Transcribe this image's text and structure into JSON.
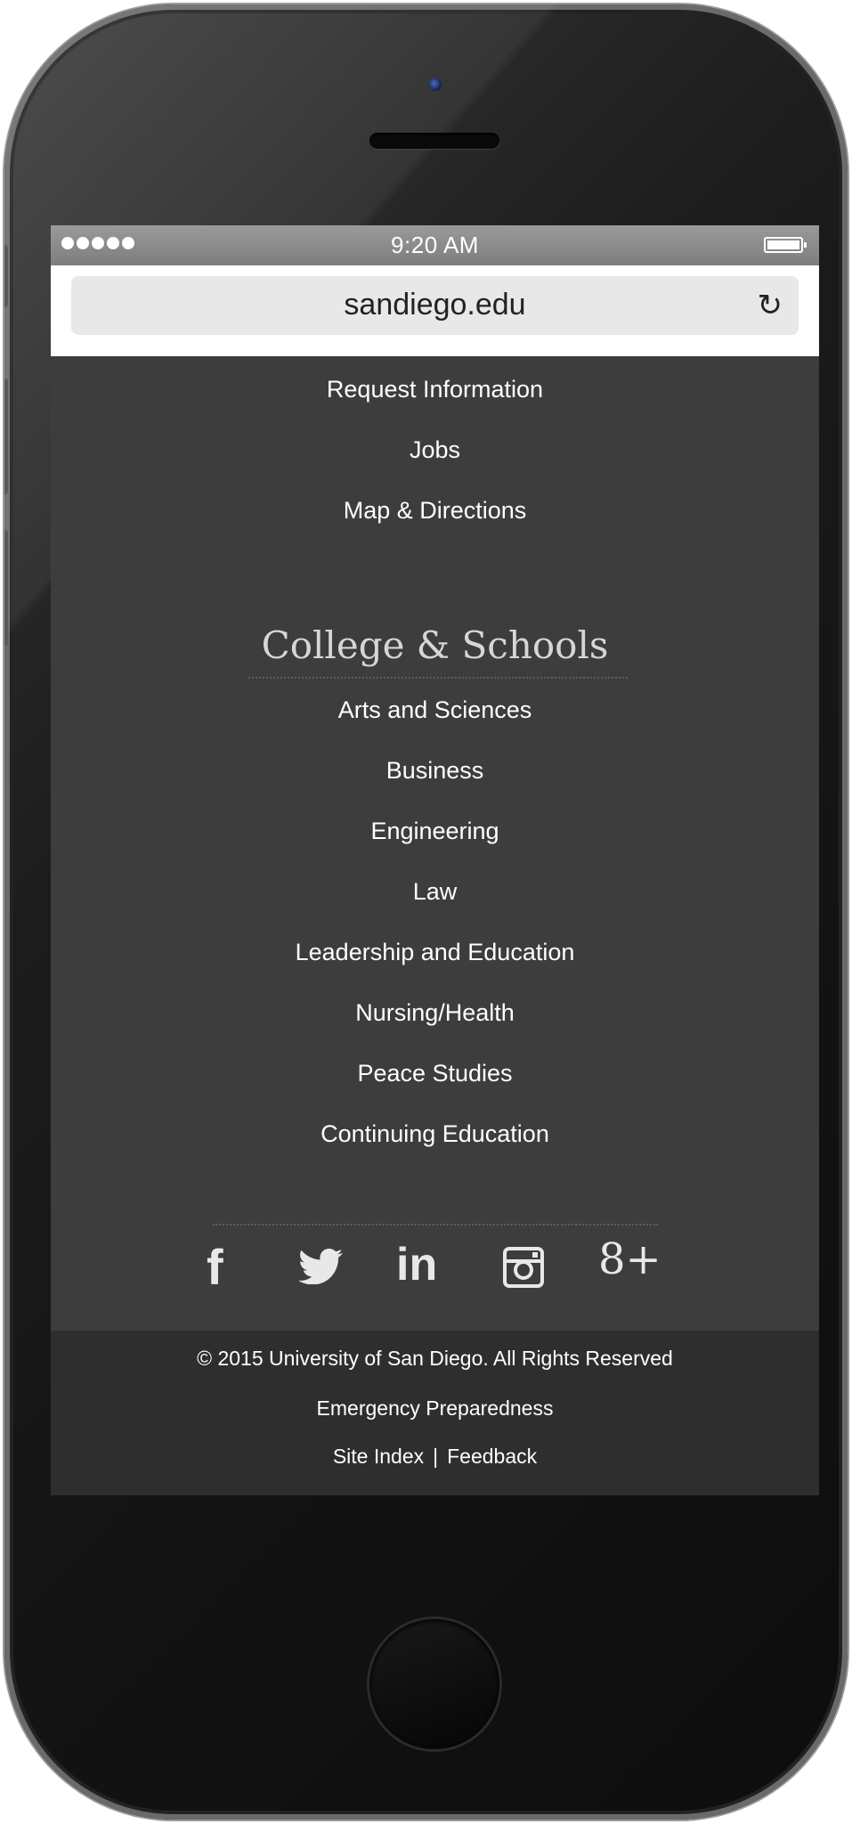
{
  "status_bar": {
    "time": "9:20 AM"
  },
  "browser": {
    "url": "sandiego.edu",
    "reload_icon": "↻"
  },
  "top_links": [
    {
      "label": "Request Information"
    },
    {
      "label": "Jobs"
    },
    {
      "label": "Map & Directions"
    }
  ],
  "schools_section": {
    "title": "College & Schools",
    "items": [
      {
        "label": "Arts and Sciences"
      },
      {
        "label": "Business"
      },
      {
        "label": "Engineering"
      },
      {
        "label": "Law"
      },
      {
        "label": "Leadership and Education"
      },
      {
        "label": "Nursing/Health"
      },
      {
        "label": "Peace Studies"
      },
      {
        "label": "Continuing Education"
      }
    ]
  },
  "social": {
    "facebook": "f",
    "twitter_icon": "twitter-bird-icon",
    "linkedin": "in",
    "instagram_icon": "instagram-camera-icon",
    "googleplus": "8+"
  },
  "footer": {
    "copyright": "©  2015 University of San Diego. All Rights Reserved",
    "emergency": "Emergency Preparedness",
    "site_index": "Site Index",
    "separator": "|",
    "feedback": "Feedback"
  },
  "colors": {
    "screen_bg": "#3d3d3d",
    "footer_bg": "#2e2e2e",
    "link_text": "#ffffff",
    "heading_text": "#d6d6d6"
  }
}
